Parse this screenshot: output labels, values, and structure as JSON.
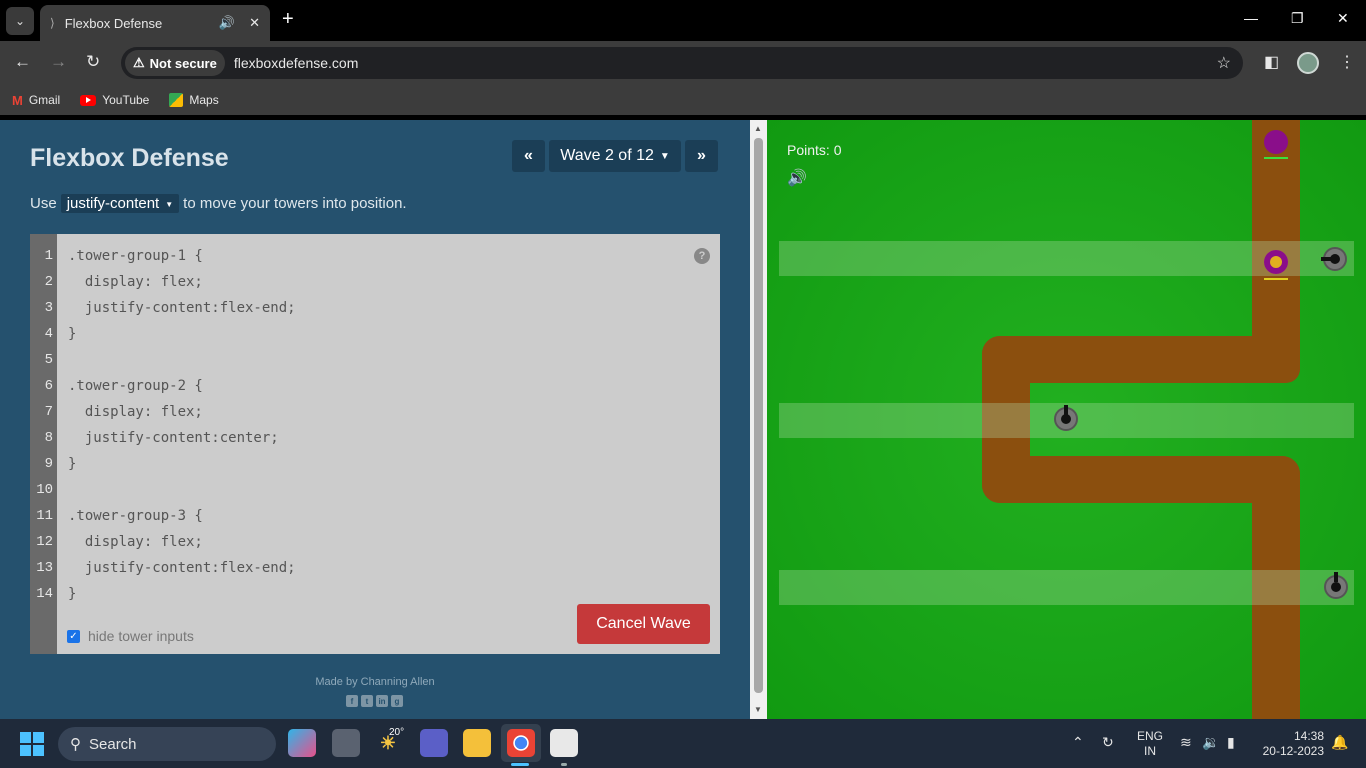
{
  "browser": {
    "tab_title": "Flexbox Defense",
    "new_tab_label": "+",
    "security_label": "Not secure",
    "url": "flexboxdefense.com",
    "bookmarks": [
      {
        "label": "Gmail"
      },
      {
        "label": "YouTube"
      },
      {
        "label": "Maps"
      }
    ]
  },
  "app": {
    "title": "Flexbox Defense",
    "wave_label": "Wave 2 of 12",
    "instruction_prefix": "Use",
    "property": "justify-content",
    "instruction_suffix": "to move your towers into position.",
    "line_numbers": [
      "1",
      "2",
      "3",
      "4",
      "5",
      "6",
      "7",
      "8",
      "9",
      "10",
      "11",
      "12",
      "13",
      "14"
    ],
    "code_lines": [
      ".tower-group-1 {",
      "  display: flex;",
      "  justify-content:flex-end;",
      "}",
      "",
      ".tower-group-2 {",
      "  display: flex;",
      "  justify-content:center;",
      "}",
      "",
      ".tower-group-3 {",
      "  display: flex;",
      "  justify-content:flex-end;",
      "}"
    ],
    "hide_inputs_label": "hide tower inputs",
    "hide_inputs_checked": true,
    "cancel_label": "Cancel Wave",
    "made_by": "Made by Channing Allen",
    "help_label": "?"
  },
  "game": {
    "points_label": "Points: 0"
  },
  "taskbar": {
    "search_label": "Search",
    "weather_temp": "20°",
    "lang_line1": "ENG",
    "lang_line2": "IN",
    "time": "14:38",
    "date": "20-12-2023"
  },
  "colors": {
    "panel_bg": "#25516e",
    "grass": "#1aa51a",
    "path": "#8b4f0e",
    "cancel": "#c5393a"
  }
}
